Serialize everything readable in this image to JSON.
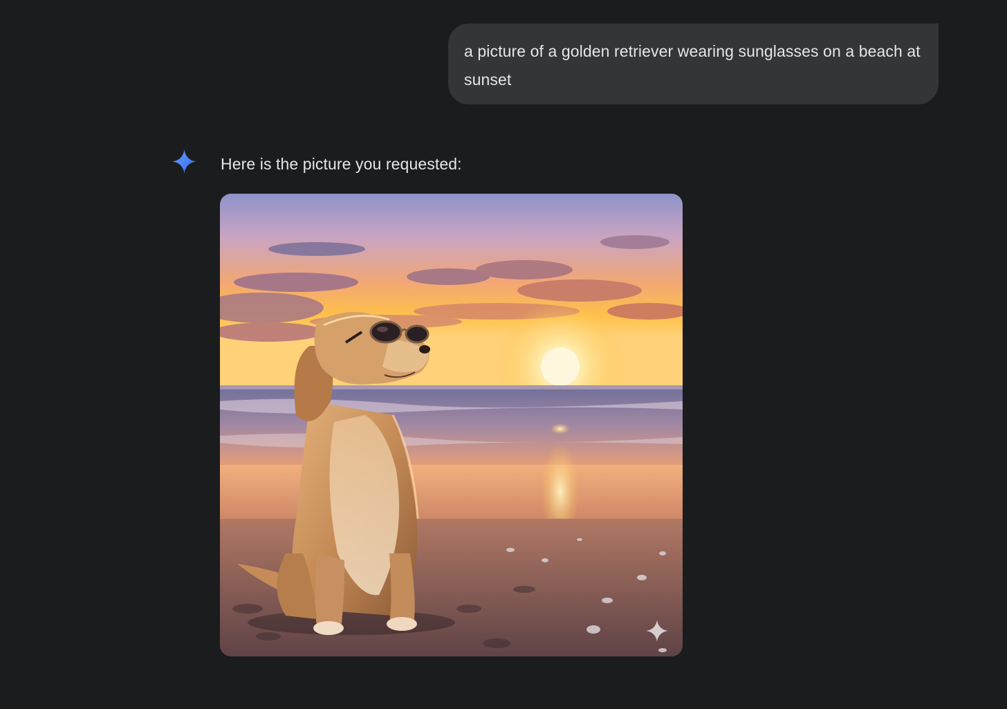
{
  "conversation": {
    "user_prompt": "a picture of a golden retriever wearing sunglasses on a beach at sunset",
    "assistant_reply": "Here is the picture you requested:",
    "assistant_icon": "sparkle-icon",
    "generated_image": {
      "watermark_icon": "sparkle-icon"
    }
  },
  "colors": {
    "background": "#1b1c1e",
    "user_bubble": "#333537",
    "text": "#e6e6e6",
    "sparkle_blue": "#4a86f7"
  }
}
